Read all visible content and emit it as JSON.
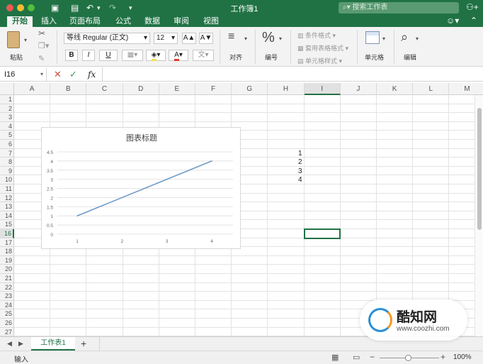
{
  "window": {
    "title": "工作簿1"
  },
  "search": {
    "placeholder": "搜索工作表"
  },
  "tabs": [
    "开始",
    "插入",
    "页面布局",
    "公式",
    "数据",
    "审阅",
    "视图"
  ],
  "ribbon": {
    "paste": "粘贴",
    "font_name": "等线 Regular (正文)",
    "font_size": "12",
    "grow": "A▲",
    "shrink": "A▼",
    "bold": "B",
    "italic": "I",
    "underline": "U",
    "align": "对齐",
    "number_symbol": "%",
    "number": "编号",
    "cond_format": "条件格式",
    "table_format": "套用表格格式",
    "cell_style": "单元格样式",
    "cells": "单元格",
    "edit": "编辑"
  },
  "formula_bar": {
    "name_box": "I16",
    "fx": "fx",
    "value": ""
  },
  "columns": [
    "A",
    "B",
    "C",
    "D",
    "E",
    "F",
    "G",
    "H",
    "I",
    "J",
    "K",
    "L",
    "M"
  ],
  "rows": [
    "1",
    "2",
    "3",
    "4",
    "5",
    "6",
    "7",
    "8",
    "9",
    "10",
    "11",
    "12",
    "13",
    "14",
    "15",
    "16",
    "17",
    "18",
    "19",
    "20",
    "21",
    "22",
    "23",
    "24",
    "25",
    "26",
    "27"
  ],
  "selected": {
    "column": "I",
    "row": "16"
  },
  "cells": [
    {
      "ref": "H7",
      "value": "1"
    },
    {
      "ref": "H8",
      "value": "2"
    },
    {
      "ref": "H9",
      "value": "3"
    },
    {
      "ref": "H10",
      "value": "4"
    }
  ],
  "chart_data": {
    "type": "line",
    "title": "图表标题",
    "x": [
      "1",
      "2",
      "3",
      "4"
    ],
    "series": [
      {
        "values": [
          1,
          2,
          3,
          4
        ]
      }
    ],
    "ylim": [
      0,
      4.5
    ],
    "yticks": [
      "0",
      "0.5",
      "1",
      "1.5",
      "2",
      "2.5",
      "3",
      "3.5",
      "4",
      "4.5"
    ],
    "grid": true,
    "line_color": "#6f9bc8"
  },
  "sheets": [
    {
      "name": "工作表1",
      "active": true
    }
  ],
  "add_sheet": "+",
  "status": {
    "mode": "输入",
    "zoom": "100%"
  },
  "watermark": {
    "brand": "酷知网",
    "url": "www.coozhi.com"
  },
  "colors": {
    "accent": "#207245"
  }
}
